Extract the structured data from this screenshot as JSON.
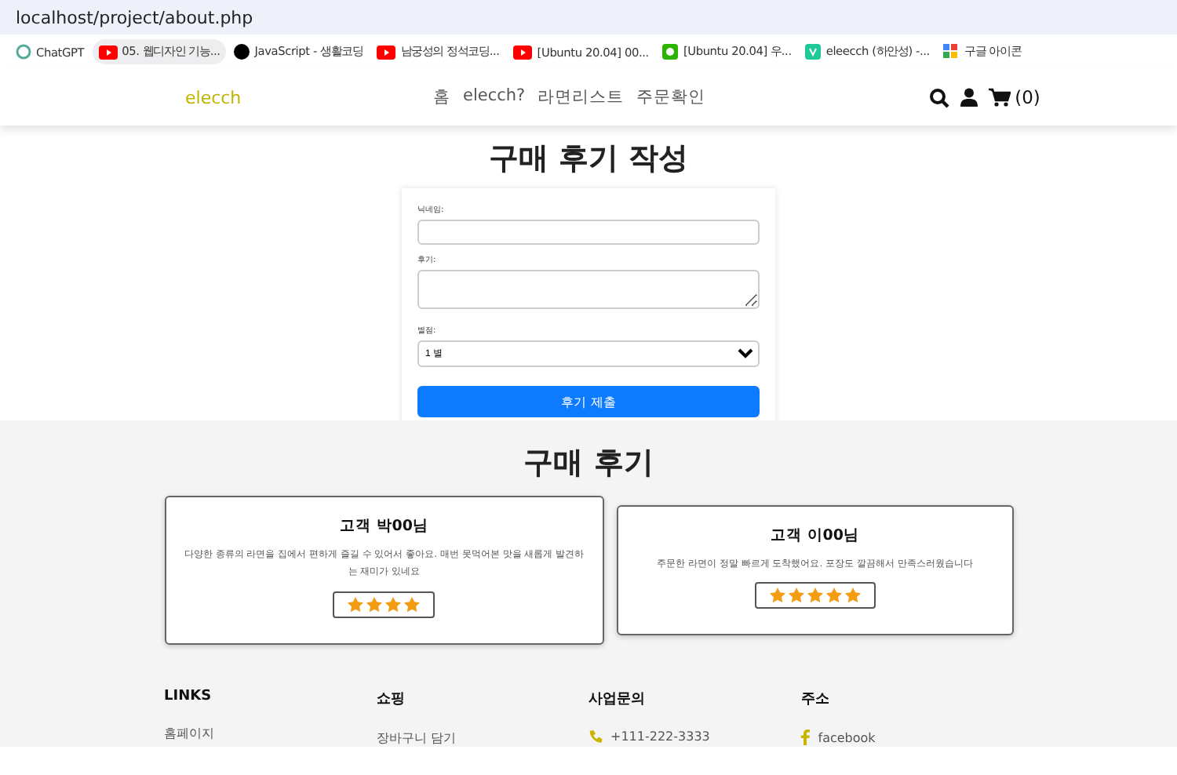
{
  "browser": {
    "url": "localhost/project/about.php",
    "bookmarks": [
      {
        "label": "ChatGPT",
        "selected": false
      },
      {
        "label": "05. 웹디자인 기능...",
        "selected": true
      },
      {
        "label": "JavaScript - 생활코딩",
        "selected": false
      },
      {
        "label": "남궁성의 정석코딩...",
        "selected": false
      },
      {
        "label": "[Ubuntu 20.04] 00...",
        "selected": false
      },
      {
        "label": "[Ubuntu 20.04] 우...",
        "selected": false
      },
      {
        "label": "eleecch (하안성) -...",
        "selected": false
      },
      {
        "label": "구글 아이콘",
        "selected": false
      }
    ]
  },
  "nav": {
    "logo": "elecch",
    "menu": [
      "홈",
      "elecch?",
      "라면리스트",
      "주문확인"
    ],
    "cart_count": "(0)"
  },
  "form": {
    "title": "구매 후기 작성",
    "fields": [
      {
        "kind": "input",
        "label": "닉네임:"
      },
      {
        "kind": "textarea",
        "label": "후기:"
      },
      {
        "kind": "select",
        "label": "별점:",
        "value": "1 별"
      }
    ],
    "submit": "후기 제출"
  },
  "reviews": {
    "title": "구매 후기",
    "items": [
      {
        "name": "고객 박00님",
        "text": "다양한 종류의 라면을 집에서 편하게 즐길 수 있어서 좋아요. 매번 못먹어본 맛을 새롭게 발견하는 재미가 있네요",
        "stars": 4
      },
      {
        "name": "고객 이00님",
        "text": "주문한 라면이 정말 빠르게 도착했어요. 포장도 깔끔해서 만족스러웠습니다",
        "stars": 5
      }
    ]
  },
  "footer": {
    "columns": [
      {
        "heading": "LINKS",
        "items": [
          "홈페이지"
        ]
      },
      {
        "heading": "쇼핑",
        "items": [
          "장바구니 담기"
        ]
      },
      {
        "heading": "사업문의",
        "items": [
          "+111-222-3333"
        ]
      },
      {
        "heading": "주소",
        "items": [
          "facebook"
        ]
      }
    ]
  }
}
